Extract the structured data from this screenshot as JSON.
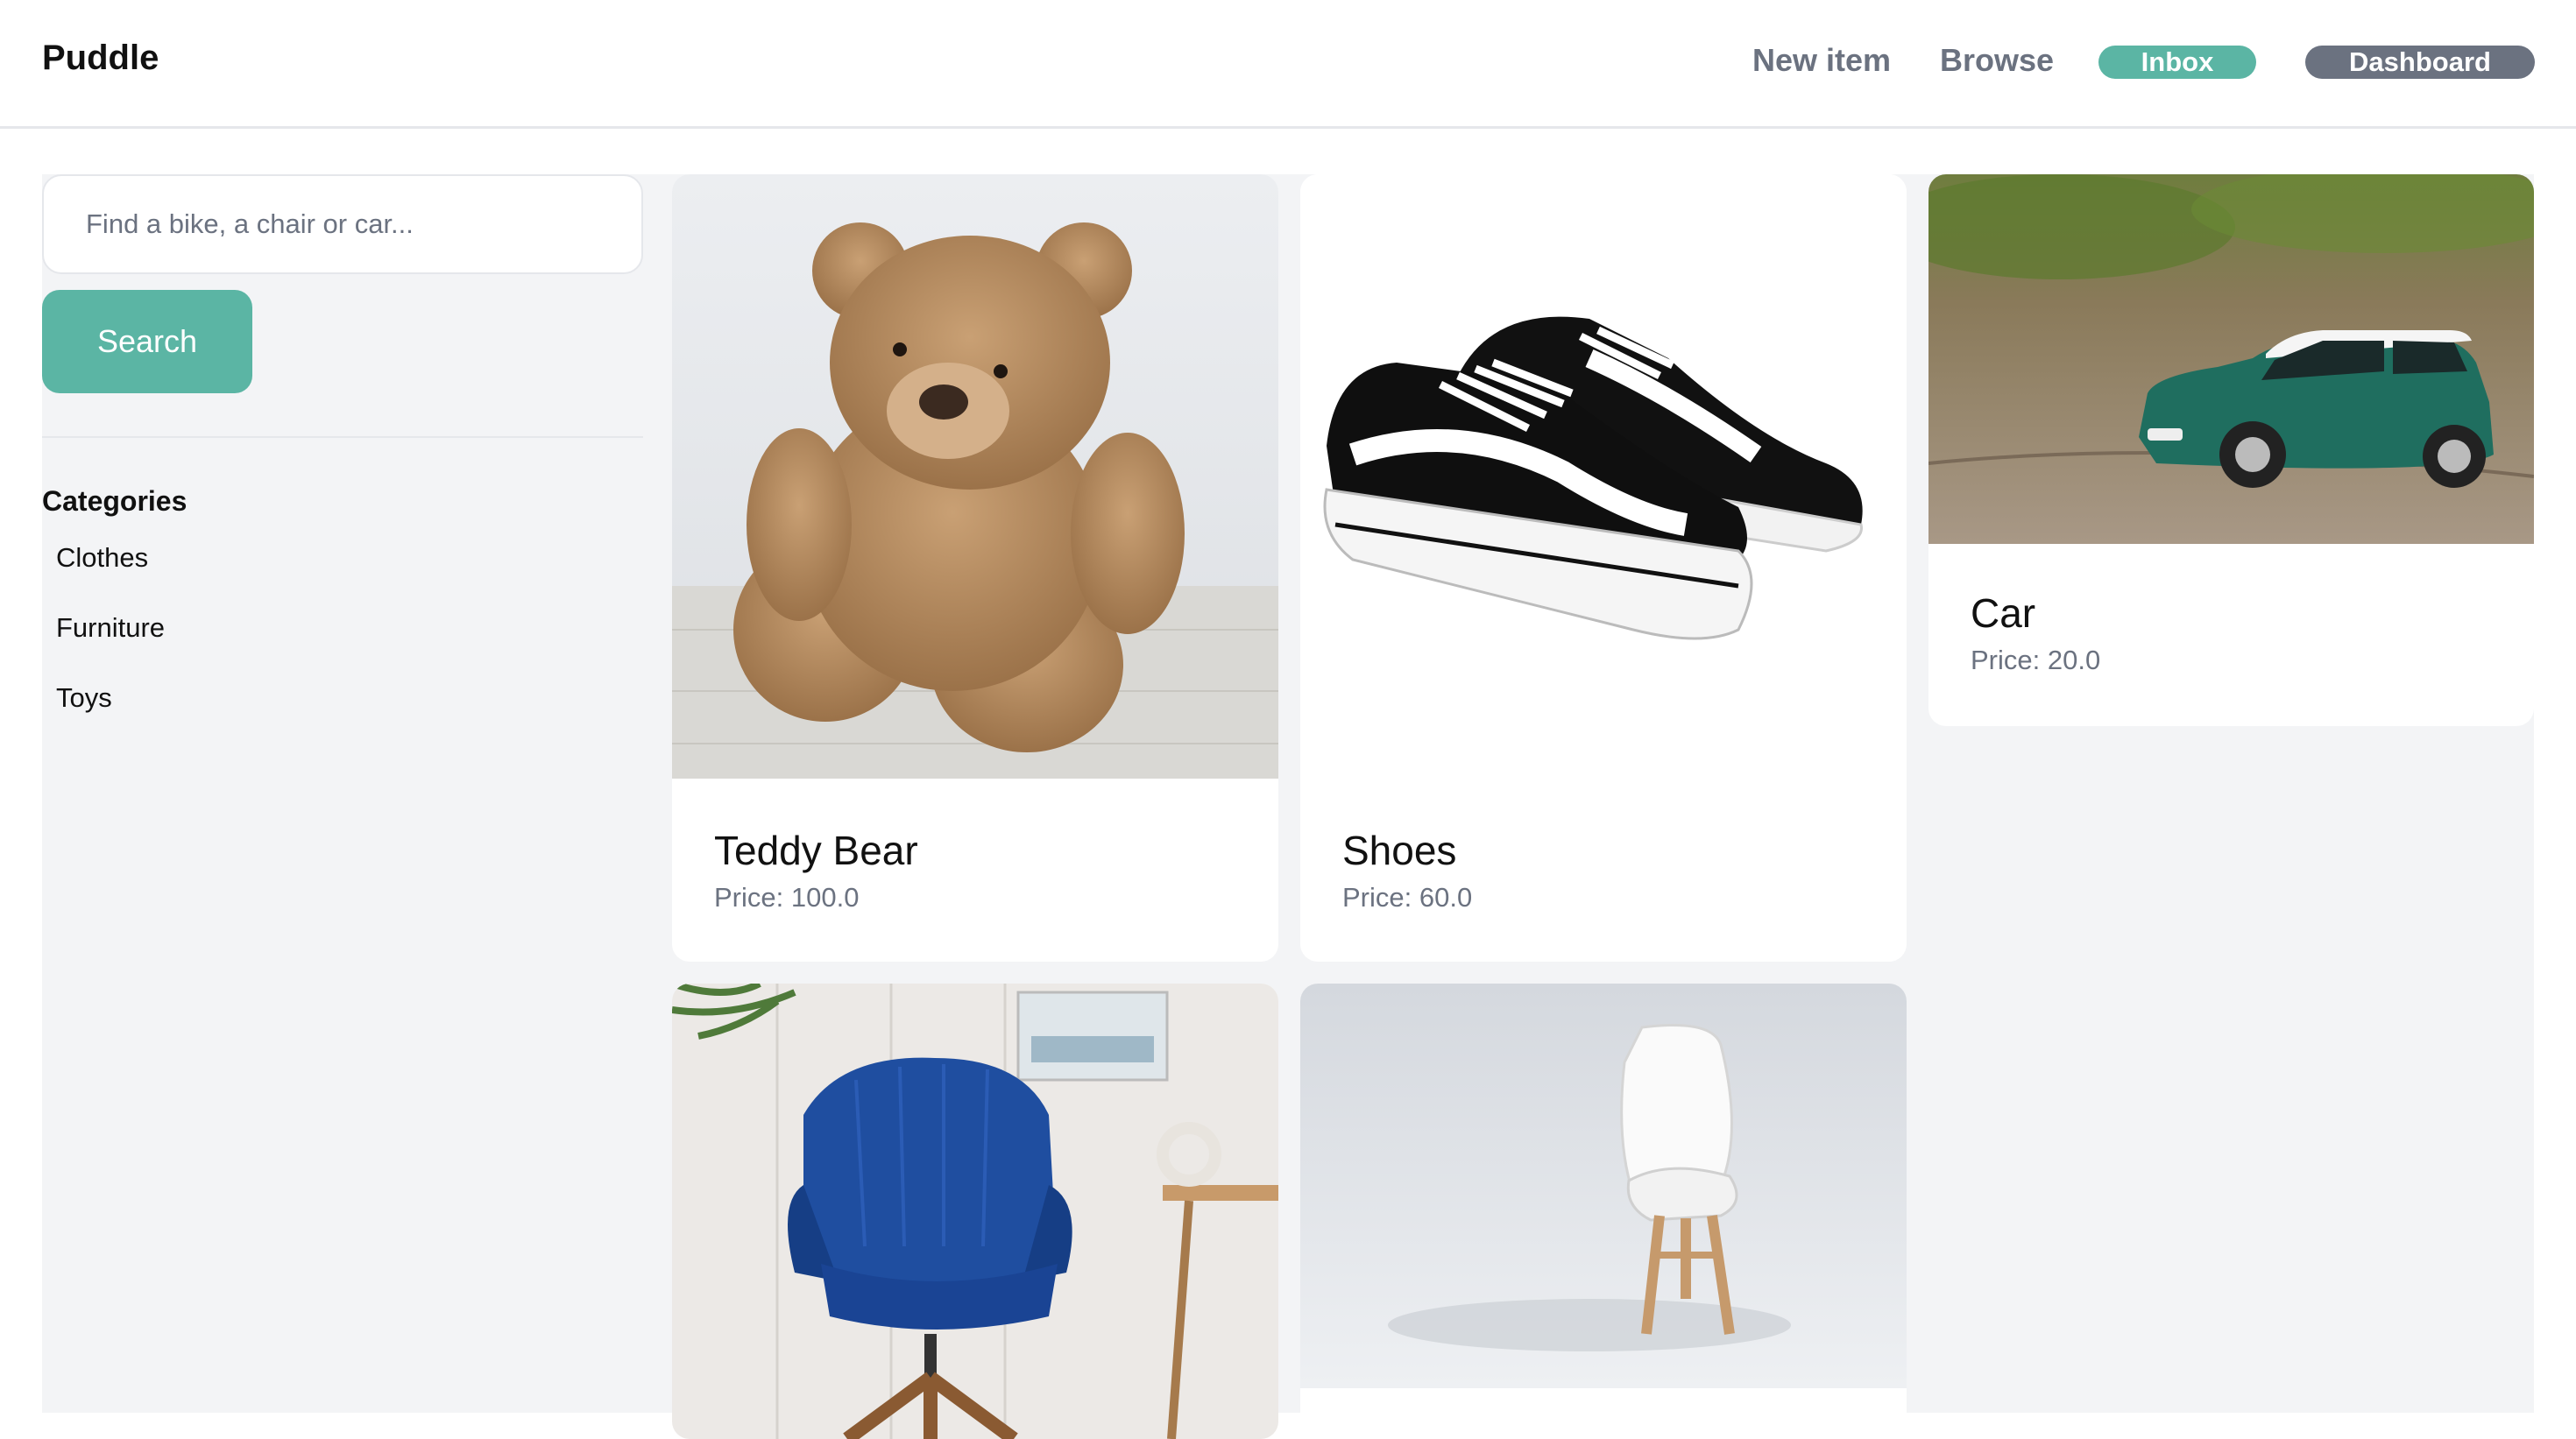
{
  "nav": {
    "brand": "Puddle",
    "new_item": "New item",
    "browse": "Browse",
    "inbox": "Inbox",
    "dashboard": "Dashboard"
  },
  "colors": {
    "accent": "#5bb5a4",
    "dark_pill": "#6b7280",
    "muted_text": "#6b7280",
    "panel_bg": "#f3f4f6"
  },
  "sidebar": {
    "search_placeholder": "Find a bike, a chair or car...",
    "search_button": "Search",
    "categories_heading": "Categories",
    "categories": [
      "Clothes",
      "Furniture",
      "Toys"
    ]
  },
  "items": [
    {
      "name": "Teddy Bear",
      "price": "Price: 100.0",
      "image": "teddy-bear-image"
    },
    {
      "name": "Shoes",
      "price": "Price: 60.0",
      "image": "sneakers-image"
    },
    {
      "name": "Car",
      "price": "Price: 20.0",
      "image": "toy-car-image"
    },
    {
      "image": "blue-armchair-image"
    },
    {
      "image": "white-chair-image"
    }
  ]
}
